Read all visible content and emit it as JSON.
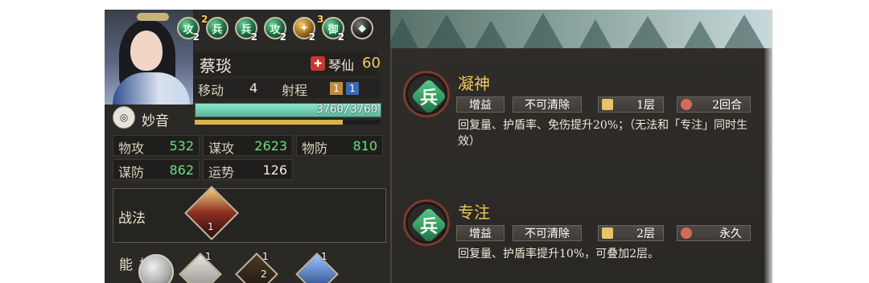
{
  "hero": {
    "name": "蔡琰",
    "role": "琴仙",
    "level": "60",
    "title": "妙音",
    "move_label": "移动",
    "move_value": "4",
    "range_label": "射程",
    "range_values": [
      "1",
      "1"
    ],
    "hp_text": "3760/3760",
    "hp_fraction": 1.0,
    "stamina_fraction": 0.8
  },
  "badges": [
    {
      "glyph": "攻",
      "count": "2",
      "top_count": "",
      "style": "green"
    },
    {
      "glyph": "兵",
      "count": "",
      "top_count": "2",
      "style": "green"
    },
    {
      "glyph": "兵",
      "count": "2",
      "top_count": "",
      "style": "green"
    },
    {
      "glyph": "攻",
      "count": "2",
      "top_count": "",
      "style": "green"
    },
    {
      "glyph": "",
      "count": "2",
      "top_count": "",
      "style": "gold"
    },
    {
      "glyph": "御",
      "count": "2",
      "top_count": "3",
      "style": "green"
    },
    {
      "glyph": "",
      "count": "",
      "top_count": "",
      "style": "dark"
    }
  ],
  "stats": {
    "atk_label": "物攻",
    "atk_value": "532",
    "int_label": "谋攻",
    "int_value": "2623",
    "def_label": "物防",
    "def_value": "810",
    "res_label": "谋防",
    "res_value": "862",
    "luck_label": "运势",
    "luck_value": "126"
  },
  "tactic": {
    "label": "战法",
    "count": "1"
  },
  "skills": {
    "label": "技能",
    "counts": [
      "1",
      "1",
      "2",
      "1"
    ]
  },
  "effects": [
    {
      "name": "凝神",
      "glyph": "兵",
      "tags": [
        "增益",
        "不可清除"
      ],
      "stacks": "1层",
      "duration": "2回合",
      "desc": "回复量、护盾率、免伤提升20%；（无法和「专注」同时生效）"
    },
    {
      "name": "专注",
      "glyph": "兵",
      "tags": [
        "增益",
        "不可清除"
      ],
      "stacks": "2层",
      "duration": "永久",
      "desc": "回复量、护盾率提升10%，可叠加2层。"
    }
  ],
  "colors": {
    "accent_gold": "#f1c75b",
    "stat_green": "#68e07d",
    "hp_teal": "#51b89a"
  }
}
